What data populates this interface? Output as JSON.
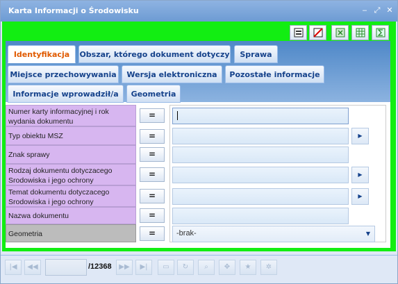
{
  "window": {
    "title": "Karta Informacji o Środowisku"
  },
  "tabs": [
    {
      "label": "Identyfikacja"
    },
    {
      "label": "Obszar, którego dokument dotyczy"
    },
    {
      "label": "Sprawa"
    },
    {
      "label": "Miejsce przechowywania"
    },
    {
      "label": "Wersja elektroniczna"
    },
    {
      "label": "Pozostałe informacje"
    },
    {
      "label": "Informacje wprowadził/a"
    },
    {
      "label": "Geometria"
    }
  ],
  "form": {
    "eq": "=",
    "rows": [
      {
        "label": "Numer karty informacyjnej i rok wydania dokumentu",
        "value": ""
      },
      {
        "label": "Typ obiektu MSZ",
        "value": ""
      },
      {
        "label": "Znak sprawy",
        "value": ""
      },
      {
        "label": "Rodzaj dokumentu dotyczacego Srodowiska i jego ochrony",
        "value": ""
      },
      {
        "label": "Temat dokumentu dotyczacego Srodowiska i jego ochrony",
        "value": ""
      },
      {
        "label": "Nazwa dokumentu",
        "value": ""
      },
      {
        "label": "Geometria",
        "value": "-brak-"
      }
    ]
  },
  "pager": {
    "total": "/12368",
    "page": ""
  },
  "colors": {
    "accent_green": "#12ee12",
    "active_tab_text": "#e05a00",
    "label_purple": "#d7b6f0"
  }
}
